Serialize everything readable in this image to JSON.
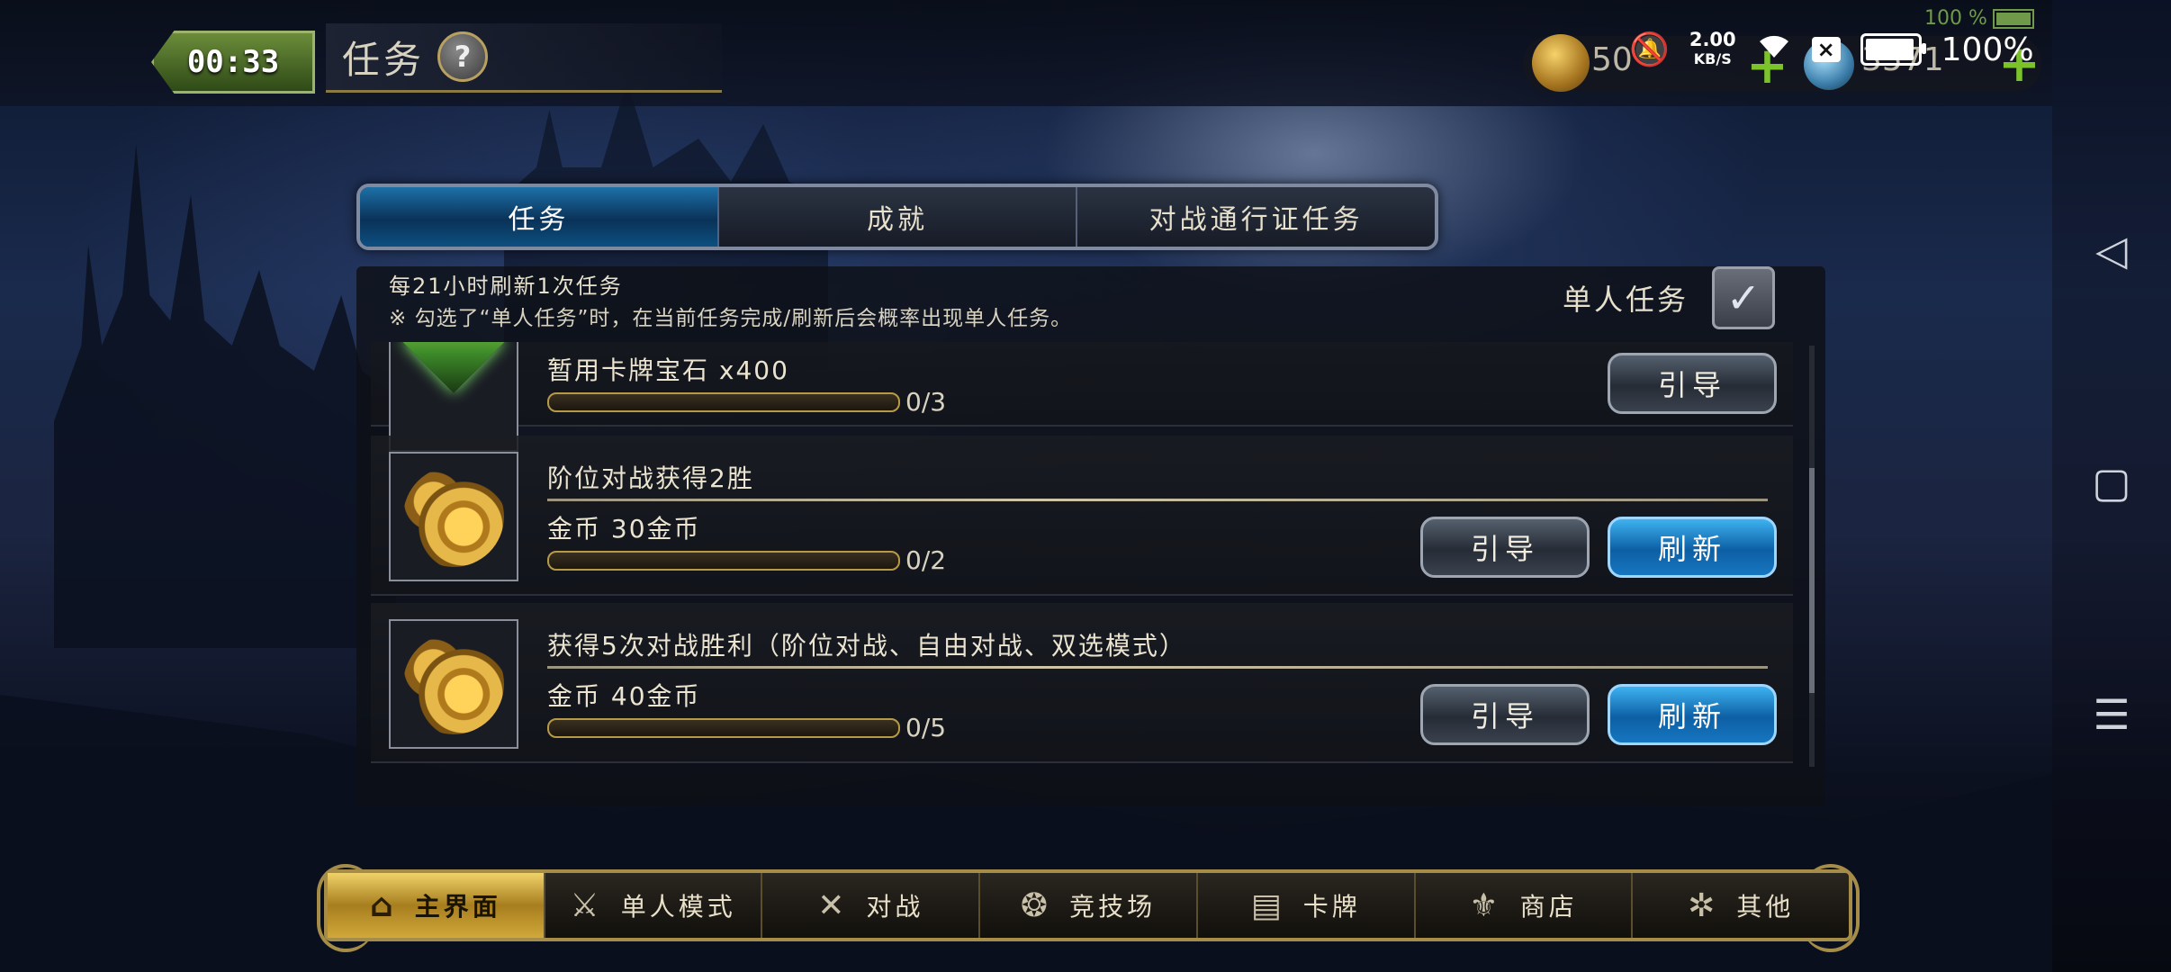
{
  "timer": "00:33",
  "page_title": "任务",
  "help_icon": "?",
  "status_bar": {
    "top_battery": "100 %",
    "net_speed_value": "2.00",
    "net_speed_unit": "KB/S",
    "battery_pct": "100%"
  },
  "currency": {
    "gold": "50",
    "gems": "3571"
  },
  "tabs": [
    {
      "label": "任务",
      "active": true
    },
    {
      "label": "成就",
      "active": false
    },
    {
      "label": "对战通行证任务",
      "active": false
    }
  ],
  "refresh_note": "每21小时刷新1次任务",
  "refresh_note_detail": "※ 勾选了“单人任务”时，在当前任务完成/刷新后会概率出现单人任务。",
  "single_task": {
    "label": "单人任务",
    "checked": true
  },
  "tasks": [
    {
      "title": "",
      "reward": "暂用卡牌宝石 x400",
      "progress": "0/3",
      "progress_fraction": 0,
      "guide_label": "引导",
      "refresh_label": ""
    },
    {
      "title": "阶位对战获得2胜",
      "reward": "金币 30金币",
      "progress": "0/2",
      "progress_fraction": 0,
      "guide_label": "引导",
      "refresh_label": "刷新"
    },
    {
      "title": "获得5次对战胜利（阶位对战、自由对战、双选模式）",
      "reward": "金币 40金币",
      "progress": "0/5",
      "progress_fraction": 0,
      "guide_label": "引导",
      "refresh_label": "刷新"
    }
  ],
  "bottom_nav": [
    {
      "label": "主界面",
      "icon": "home-icon",
      "active": true
    },
    {
      "label": "单人模式",
      "icon": "sword-shield-icon",
      "active": false
    },
    {
      "label": "对战",
      "icon": "crossed-swords-icon",
      "active": false
    },
    {
      "label": "竞技场",
      "icon": "arena-icon",
      "active": false
    },
    {
      "label": "卡牌",
      "icon": "cards-icon",
      "active": false
    },
    {
      "label": "商店",
      "icon": "shop-icon",
      "active": false
    },
    {
      "label": "其他",
      "icon": "other-icon",
      "active": false
    }
  ],
  "colors": {
    "accent_blue": "#0d5fa4",
    "gold": "#e2c060",
    "back_green": "#4b6d27"
  }
}
